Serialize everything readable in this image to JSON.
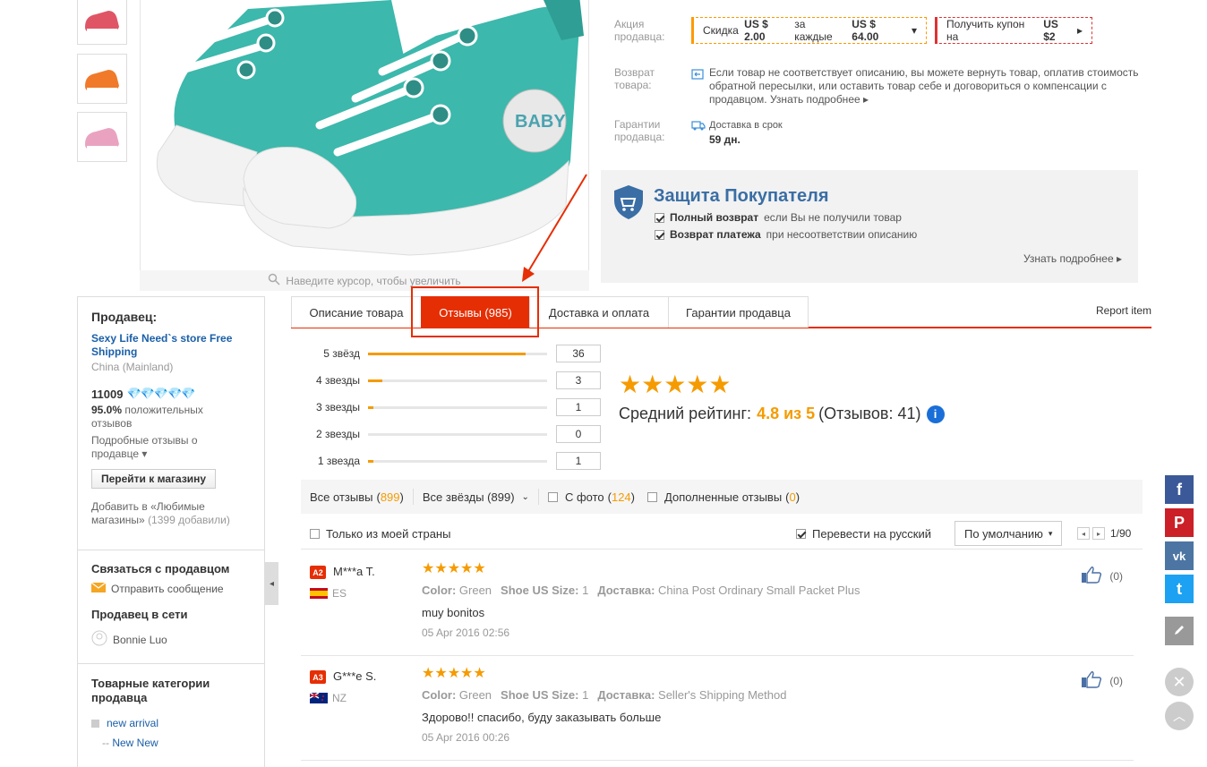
{
  "gallery": {
    "zoom_hint": "Наведите курсор, чтобы увеличить"
  },
  "info": {
    "promo_label_1": "Акция",
    "promo_label_2": "продавца:",
    "coupon1_pre": "Скидка",
    "coupon1_amount": "US $ 2.00",
    "coupon1_mid": "за каждые",
    "coupon1_threshold": "US $ 64.00",
    "coupon2_pre": "Получить купон на",
    "coupon2_amount": "US $2",
    "return_label_1": "Возврат",
    "return_label_2": "товара:",
    "return_line1": "Если товар не соответствует описанию, вы можете вернуть товар, оплатив стоимость",
    "return_line2": "обратной пересылки, или оставить товар себе и договориться о компенсации с",
    "return_line3": "продавцом.",
    "return_more": "Узнать подробнее",
    "guarantee_label_1": "Гарантии",
    "guarantee_label_2": "продавца:",
    "delivery_label": "Доставка в срок",
    "delivery_days": "59 дн."
  },
  "protection": {
    "title": "Защита Покупателя",
    "line1_bold": "Полный возврат",
    "line1_rest": "если Вы не получили товар",
    "line2_bold": "Возврат платежа",
    "line2_rest": "при несоответствии описанию",
    "more": "Узнать подробнее"
  },
  "seller": {
    "heading": "Продавец:",
    "store_name": "Sexy Life Need`s store Free Shipping",
    "country": "China (Mainland)",
    "score": "11009",
    "positive_pct": "95.0%",
    "positive_text_1": "положительных",
    "positive_text_2": "отзывов",
    "detailed_1": "Подробные отзывы о",
    "detailed_2": "продавце",
    "store_button": "Перейти к магазину",
    "fav_1": "Добавить в «Любимые",
    "fav_2": "магазины»",
    "fav_count": "(1399 добавили)",
    "contact_heading": "Связаться с продавцом",
    "send_message": "Отправить сообщение",
    "online_heading": "Продавец в сети",
    "online_name": "Bonnie Luo",
    "categories_heading_1": "Товарные категории",
    "categories_heading_2": "продавца",
    "cat1": "new arrival",
    "cat2": "New New"
  },
  "tabs": {
    "description": "Описание товара",
    "reviews": "Отзывы (985)",
    "shipping": "Доставка и оплата",
    "guarantees": "Гарантии продавца",
    "report": "Report item"
  },
  "rating": {
    "histogram": [
      {
        "label": "5 звёзд",
        "count": "36",
        "fraction": 0.88
      },
      {
        "label": "4 звезды",
        "count": "3",
        "fraction": 0.08
      },
      {
        "label": "3 звезды",
        "count": "1",
        "fraction": 0.03
      },
      {
        "label": "2 звезды",
        "count": "0",
        "fraction": 0.0
      },
      {
        "label": "1 звезда",
        "count": "1",
        "fraction": 0.03
      }
    ],
    "stars": "★★★★★",
    "avg_label": "Средний рейтинг:",
    "avg_value": "4.8 из 5",
    "avg_count": "(Отзывов: 41)",
    "info_icon": "i"
  },
  "filters": {
    "all_reviews": "Все отзывы",
    "all_count": "899",
    "all_stars": "Все звёзды (899)",
    "with_photo": "С фото",
    "photo_count": "124",
    "additional": "Дополненные отзывы",
    "additional_count": "0",
    "my_country": "Только из моей страны",
    "translate": "Перевести на русский",
    "sort": "По умолчанию",
    "pages": "1/90"
  },
  "reviews": [
    {
      "badge": "A2",
      "name": "M***a T.",
      "country": "ES",
      "stars": "★★★★★",
      "color_k": "Color:",
      "color_v": "Green",
      "size_k": "Shoe US Size:",
      "size_v": "1",
      "ship_k": "Доставка:",
      "ship_v": "China Post Ordinary Small Packet Plus",
      "text": "muy bonitos",
      "date": "05 Apr 2016 02:56",
      "likes": "(0)"
    },
    {
      "badge": "A3",
      "name": "G***e S.",
      "country": "NZ",
      "stars": "★★★★★",
      "color_k": "Color:",
      "color_v": "Green",
      "size_k": "Shoe US Size:",
      "size_v": "1",
      "ship_k": "Доставка:",
      "ship_v": "Seller's Shipping Method",
      "text": "Здорово!! спасибо, буду заказывать больше",
      "date": "05 Apr 2016 00:26",
      "likes": "(0)"
    }
  ],
  "social": {
    "facebook": "f",
    "pinterest": "P",
    "vk": "vk",
    "twitter": "t"
  },
  "colors": {
    "accent": "#e62e04",
    "star": "#f59b00",
    "link": "#1a5fa8"
  }
}
